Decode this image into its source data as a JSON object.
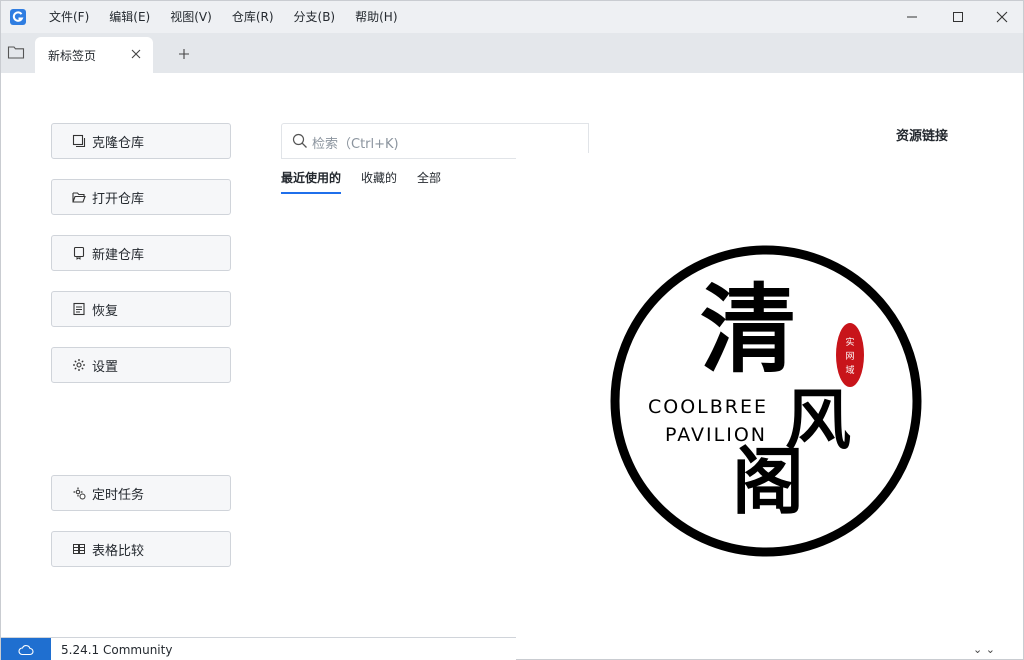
{
  "menu": [
    "文件(F)",
    "编辑(E)",
    "视图(V)",
    "仓库(R)",
    "分支(B)",
    "帮助(H)"
  ],
  "tab": {
    "label": "新标签页"
  },
  "actions": {
    "clone": "克隆仓库",
    "open": "打开仓库",
    "create": "新建仓库",
    "restore": "恢复",
    "settings": "设置",
    "scheduled": "定时任务",
    "compare": "表格比较"
  },
  "search": {
    "placeholder": "检索（Ctrl+K)"
  },
  "repo_tabs": [
    "最近使用的",
    "收藏的",
    "全部"
  ],
  "resources": {
    "title": "资源链接"
  },
  "logo": {
    "big1": "清",
    "big2": "风",
    "big3": "阁",
    "en1": "COOLBREE",
    "en2": "PAVILION",
    "stamp": "实网域"
  },
  "status": {
    "version": "5.24.1 Community"
  },
  "colors": {
    "accent": "#1f6feb",
    "status_button": "#1f6fd0"
  }
}
